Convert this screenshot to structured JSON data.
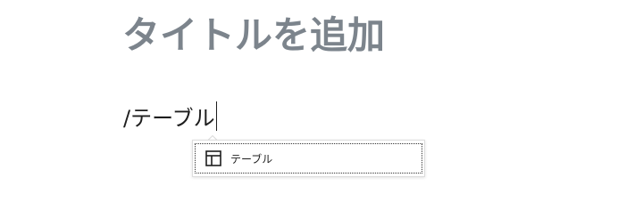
{
  "editor": {
    "title_placeholder": "タイトルを追加",
    "block_text": "/テーブル"
  },
  "autocomplete": {
    "options": [
      {
        "label": "テーブル",
        "icon": "table-icon"
      }
    ]
  },
  "colors": {
    "title": "#7c848c",
    "text": "#1e1e1e"
  }
}
